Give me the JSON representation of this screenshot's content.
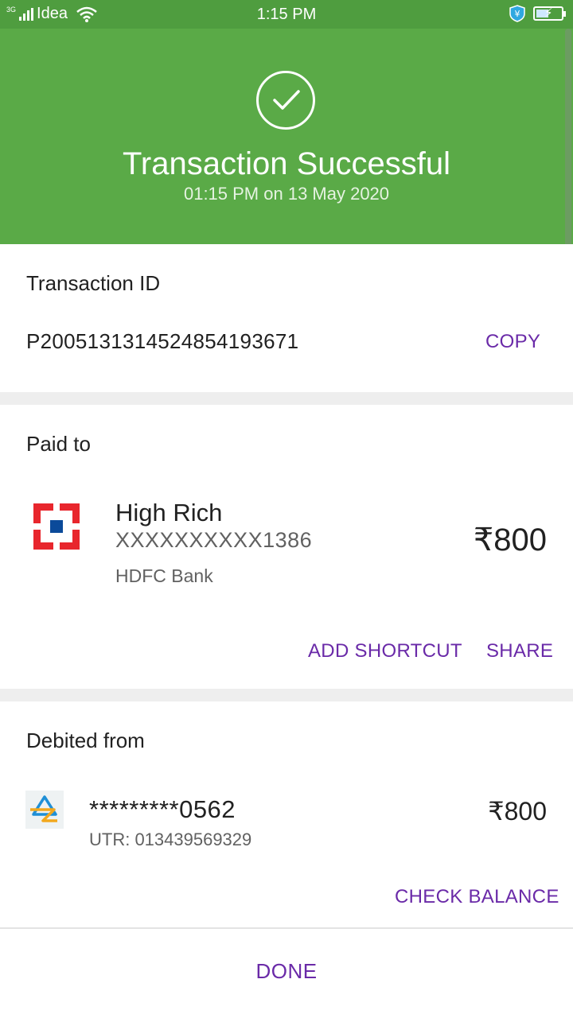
{
  "status_bar": {
    "network_type": "3G",
    "carrier": "Idea",
    "time": "1:15 PM"
  },
  "hero": {
    "title": "Transaction Successful",
    "subtitle": "01:15 PM on 13 May 2020",
    "background": "#5aaa47"
  },
  "transaction": {
    "label": "Transaction ID",
    "id": "P2005131314524854193671",
    "copy_label": "COPY"
  },
  "paid_to": {
    "label": "Paid to",
    "name": "High Rich",
    "account": "XXXXXXXXXX1386",
    "bank": "HDFC Bank",
    "amount": "₹800",
    "add_shortcut_label": "ADD SHORTCUT",
    "share_label": "SHARE"
  },
  "debited_from": {
    "label": "Debited from",
    "account": "*********0562",
    "utr": "UTR: 013439569329",
    "amount": "₹800",
    "check_balance_label": "CHECK BALANCE"
  },
  "footer": {
    "done_label": "DONE"
  },
  "colors": {
    "accent": "#6a2aa8",
    "success": "#5aaa47"
  }
}
